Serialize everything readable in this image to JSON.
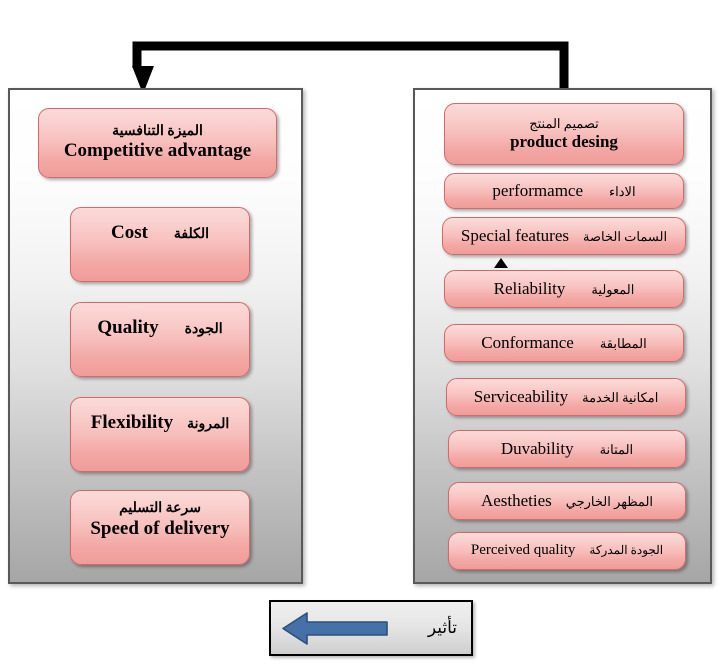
{
  "diagram": {
    "title_semantic": "competitive-advantage-and-product-design-quality-dimensions",
    "left_panel": {
      "name": "competitive-advantage-panel",
      "boxes": [
        {
          "id": "competitive-advantage",
          "arabic": "الميزة التنافسية",
          "english": "Competitive advantage",
          "layout": "stacked"
        },
        {
          "id": "cost",
          "arabic": "الكلفة",
          "english": "Cost",
          "layout": "inline"
        },
        {
          "id": "quality",
          "arabic": "الجودة",
          "english": "Quality",
          "layout": "inline"
        },
        {
          "id": "flexibility",
          "arabic": "المرونة",
          "english": "Flexibility",
          "layout": "inline"
        },
        {
          "id": "speed-of-delivery",
          "arabic": "سرعة التسليم",
          "english": "Speed of delivery",
          "layout": "stacked"
        }
      ]
    },
    "right_panel": {
      "name": "product-design-panel",
      "boxes": [
        {
          "id": "product-design",
          "arabic": "تصميم المنتج",
          "english": "product    desing",
          "layout": "stacked"
        },
        {
          "id": "performance",
          "arabic": "الاداء",
          "english": "performamce",
          "layout": "inline"
        },
        {
          "id": "special-features",
          "arabic": "السمات الخاصة",
          "english": "Special features",
          "layout": "inline-rtl"
        },
        {
          "id": "reliability",
          "arabic": "المعولية",
          "english": "Reliability",
          "layout": "inline"
        },
        {
          "id": "conformance",
          "arabic": "المطابقة",
          "english": "Conformance",
          "layout": "inline"
        },
        {
          "id": "serviceability",
          "arabic": "امكانية الخدمة",
          "english": "Serviceability",
          "layout": "inline"
        },
        {
          "id": "durability",
          "arabic": "المتانة",
          "english": "Duvability",
          "layout": "inline"
        },
        {
          "id": "aesthetics",
          "arabic": "المظهر الخارجي",
          "english": "Aestheties",
          "layout": "inline-rtl"
        },
        {
          "id": "perceived-quality",
          "arabic": "الجودة المدركة",
          "english": "Perceived quality",
          "layout": "inline-rtl"
        }
      ]
    },
    "legend": {
      "name": "influence-legend",
      "label": "تأثير",
      "arrow_direction": "left",
      "arrow_color": "#4472A8"
    },
    "connector": {
      "name": "influence-connector-arrow",
      "color": "#000000",
      "direction": "right-to-left-down"
    },
    "colors": {
      "box_fill_top": "#fbdad8",
      "box_fill_bottom": "#f09c99",
      "box_border": "#d06b6b",
      "panel_border": "#595959",
      "legend_arrow": "#4472A8",
      "text": "#000000"
    }
  }
}
